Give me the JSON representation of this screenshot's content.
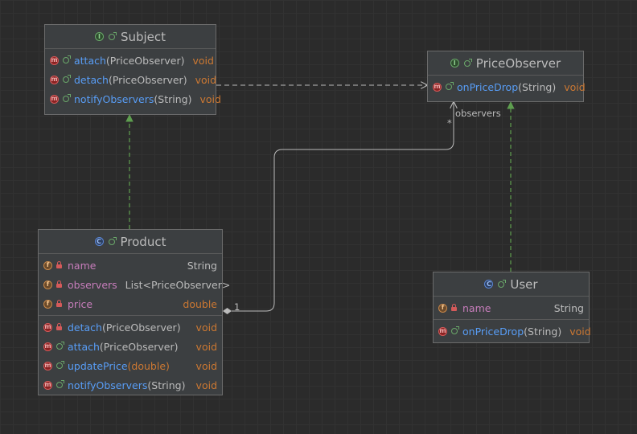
{
  "colors": {
    "background": "#2b2b2b",
    "node_fill": "#3c3f41",
    "edge": "#bbbbbb",
    "realization": "#5e9e4f",
    "method_name": "#589df6",
    "field_name": "#c77dbb",
    "type_keyword": "#cc7832"
  },
  "subject": {
    "title": "Subject",
    "kind_icon": "interface-icon",
    "methods": [
      {
        "name": "attach",
        "params": "(PriceObserver)",
        "ret": "void"
      },
      {
        "name": "detach",
        "params": "(PriceObserver)",
        "ret": "void"
      },
      {
        "name": "notifyObservers",
        "params": "(String)",
        "ret": "void"
      }
    ]
  },
  "price_observer": {
    "title": "PriceObserver",
    "kind_icon": "interface-icon",
    "methods": [
      {
        "name": "onPriceDrop",
        "params": "(String)",
        "ret": "void"
      }
    ]
  },
  "product": {
    "title": "Product",
    "kind_icon": "class-icon",
    "fields": [
      {
        "name": "name",
        "type": "String"
      },
      {
        "name": "observers",
        "type": "List<PriceObserver>"
      },
      {
        "name": "price",
        "type": "double"
      }
    ],
    "methods": [
      {
        "name": "detach",
        "params": "(PriceObserver)",
        "ret": "void"
      },
      {
        "name": "attach",
        "params": "(PriceObserver)",
        "ret": "void"
      },
      {
        "name": "updatePrice",
        "params": "(double)",
        "ret": "void"
      },
      {
        "name": "notifyObservers",
        "params": "(String)",
        "ret": "void"
      }
    ]
  },
  "user": {
    "title": "User",
    "kind_icon": "class-icon",
    "fields": [
      {
        "name": "name",
        "type": "String"
      }
    ],
    "methods": [
      {
        "name": "onPriceDrop",
        "params": "(String)",
        "ret": "void"
      }
    ]
  },
  "edges": {
    "association_role": "observers",
    "association_target_mult": "*",
    "association_source_mult": "1"
  }
}
